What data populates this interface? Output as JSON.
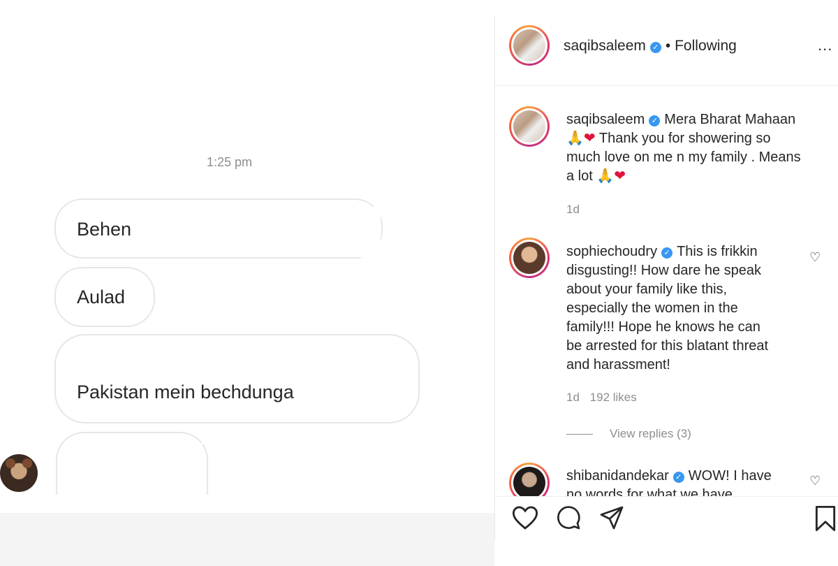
{
  "chat": {
    "timestamp": "1:25 pm",
    "messages": [
      "Behen",
      "Aulad",
      "Pakistan mein bechdunga"
    ]
  },
  "post": {
    "header": {
      "username": "saqibsaleem",
      "following": "Following",
      "more": "..."
    },
    "caption": {
      "username": "saqibsaleem",
      "line1": "Mera Bharat Mahaan",
      "line2": "Thank you for showering so",
      "line3": "much love on me n my family . Means",
      "line4": "a lot",
      "age": "1d"
    },
    "comments": [
      {
        "username": "sophiechoudry",
        "lines": [
          "This is frikkin",
          "disgusting!! How dare he speak",
          "about your family like this,",
          "especially the women in the",
          "family!!! Hope he knows he can",
          "be arrested for this blatant threat",
          "and harassment!"
        ],
        "age": "1d",
        "likes": "192 likes",
        "view_replies": "View replies (3)"
      },
      {
        "username": "shibanidandekar",
        "lines": [
          "WOW! I have",
          "no words for what we have"
        ]
      }
    ]
  },
  "icons": {
    "heart": "heart-icon",
    "comment": "comment-icon",
    "share": "share-icon",
    "bookmark": "bookmark-icon",
    "verified": "verified-badge-icon"
  },
  "colors": {
    "verified": "#3897f0",
    "muted": "#8e8e8e",
    "heart_emoji": "#e0143c"
  }
}
